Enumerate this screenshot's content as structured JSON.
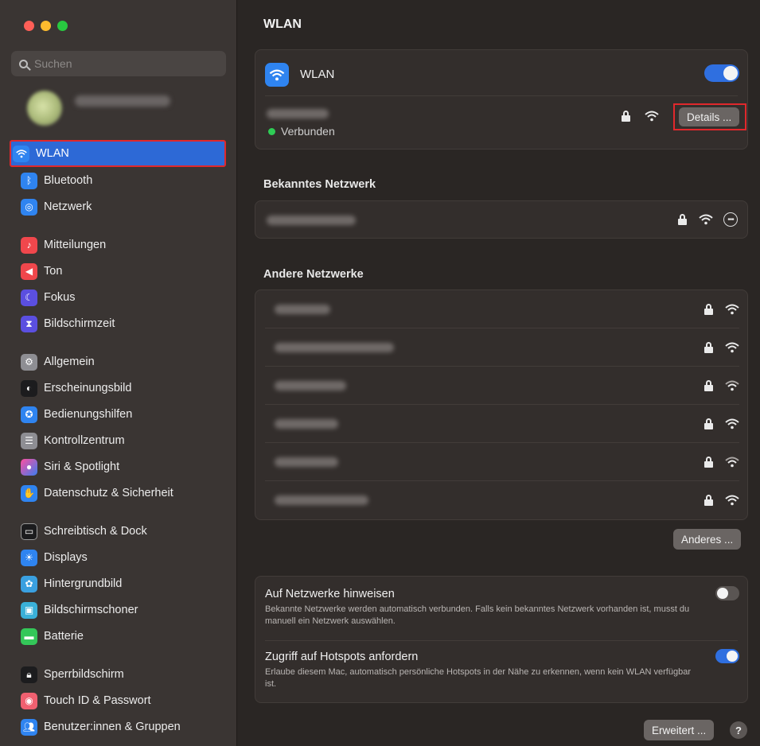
{
  "window": {
    "traffic_lights": [
      "#ff5f57",
      "#febc2e",
      "#28c840"
    ]
  },
  "sidebar": {
    "search_placeholder": "Suchen",
    "items": [
      {
        "label": "WLAN",
        "icon": "wifi-icon",
        "color": "#2f84f0",
        "selected": true
      },
      {
        "label": "Bluetooth",
        "icon": "bluetooth-icon",
        "color": "#2f84f0"
      },
      {
        "label": "Netzwerk",
        "icon": "globe-icon",
        "color": "#2f84f0"
      },
      {
        "label": "Mitteilungen",
        "icon": "bell-icon",
        "color": "#f0474c"
      },
      {
        "label": "Ton",
        "icon": "speaker-icon",
        "color": "#f0474c"
      },
      {
        "label": "Fokus",
        "icon": "moon-icon",
        "color": "#5b4fe0"
      },
      {
        "label": "Bildschirmzeit",
        "icon": "hourglass-icon",
        "color": "#5b4fe0"
      },
      {
        "label": "Allgemein",
        "icon": "gear-icon",
        "color": "#8e8e93"
      },
      {
        "label": "Erscheinungsbild",
        "icon": "appearance-icon",
        "color": "#1c1c1e"
      },
      {
        "label": "Bedienungshilfen",
        "icon": "accessibility-icon",
        "color": "#2f84f0"
      },
      {
        "label": "Kontrollzentrum",
        "icon": "switches-icon",
        "color": "#8e8e93"
      },
      {
        "label": "Siri & Spotlight",
        "icon": "siri-icon",
        "color": "#7a3ad0"
      },
      {
        "label": "Datenschutz & Sicherheit",
        "icon": "hand-icon",
        "color": "#2f84f0"
      },
      {
        "label": "Schreibtisch & Dock",
        "icon": "dock-icon",
        "color": "#1c1c1e"
      },
      {
        "label": "Displays",
        "icon": "sun-icon",
        "color": "#2f84f0"
      },
      {
        "label": "Hintergrundbild",
        "icon": "flower-icon",
        "color": "#3aa0e0"
      },
      {
        "label": "Bildschirmschoner",
        "icon": "screensaver-icon",
        "color": "#3ab0d8"
      },
      {
        "label": "Batterie",
        "icon": "battery-icon",
        "color": "#34c759"
      },
      {
        "label": "Sperrbildschirm",
        "icon": "lock-icon",
        "color": "#1c1c1e"
      },
      {
        "label": "Touch ID & Passwort",
        "icon": "fingerprint-icon",
        "color": "#f06070"
      },
      {
        "label": "Benutzer:innen & Gruppen",
        "icon": "users-icon",
        "color": "#2f84f0"
      }
    ]
  },
  "main": {
    "title": "WLAN",
    "wlan_label": "WLAN",
    "wlan_enabled": true,
    "connected_status": "Verbunden",
    "details_label": "Details ...",
    "known_section_title": "Bekanntes Netzwerk",
    "other_section_title": "Andere Netzwerke",
    "other_networks_count": 6,
    "other_button_label": "Anderes ...",
    "ask_join": {
      "title": "Auf Netzwerke hinweisen",
      "description": "Bekannte Netzwerke werden automatisch verbunden. Falls kein bekanntes Netzwerk vorhanden ist, musst du manuell ein Netzwerk auswählen.",
      "enabled": false
    },
    "hotspot": {
      "title": "Zugriff auf Hotspots anfordern",
      "description": "Erlaube diesem Mac, automatisch persönliche Hotspots in der Nähe zu erkennen, wenn kein WLAN verfügbar ist.",
      "enabled": true
    },
    "advanced_label": "Erweitert ...",
    "help_label": "?"
  }
}
